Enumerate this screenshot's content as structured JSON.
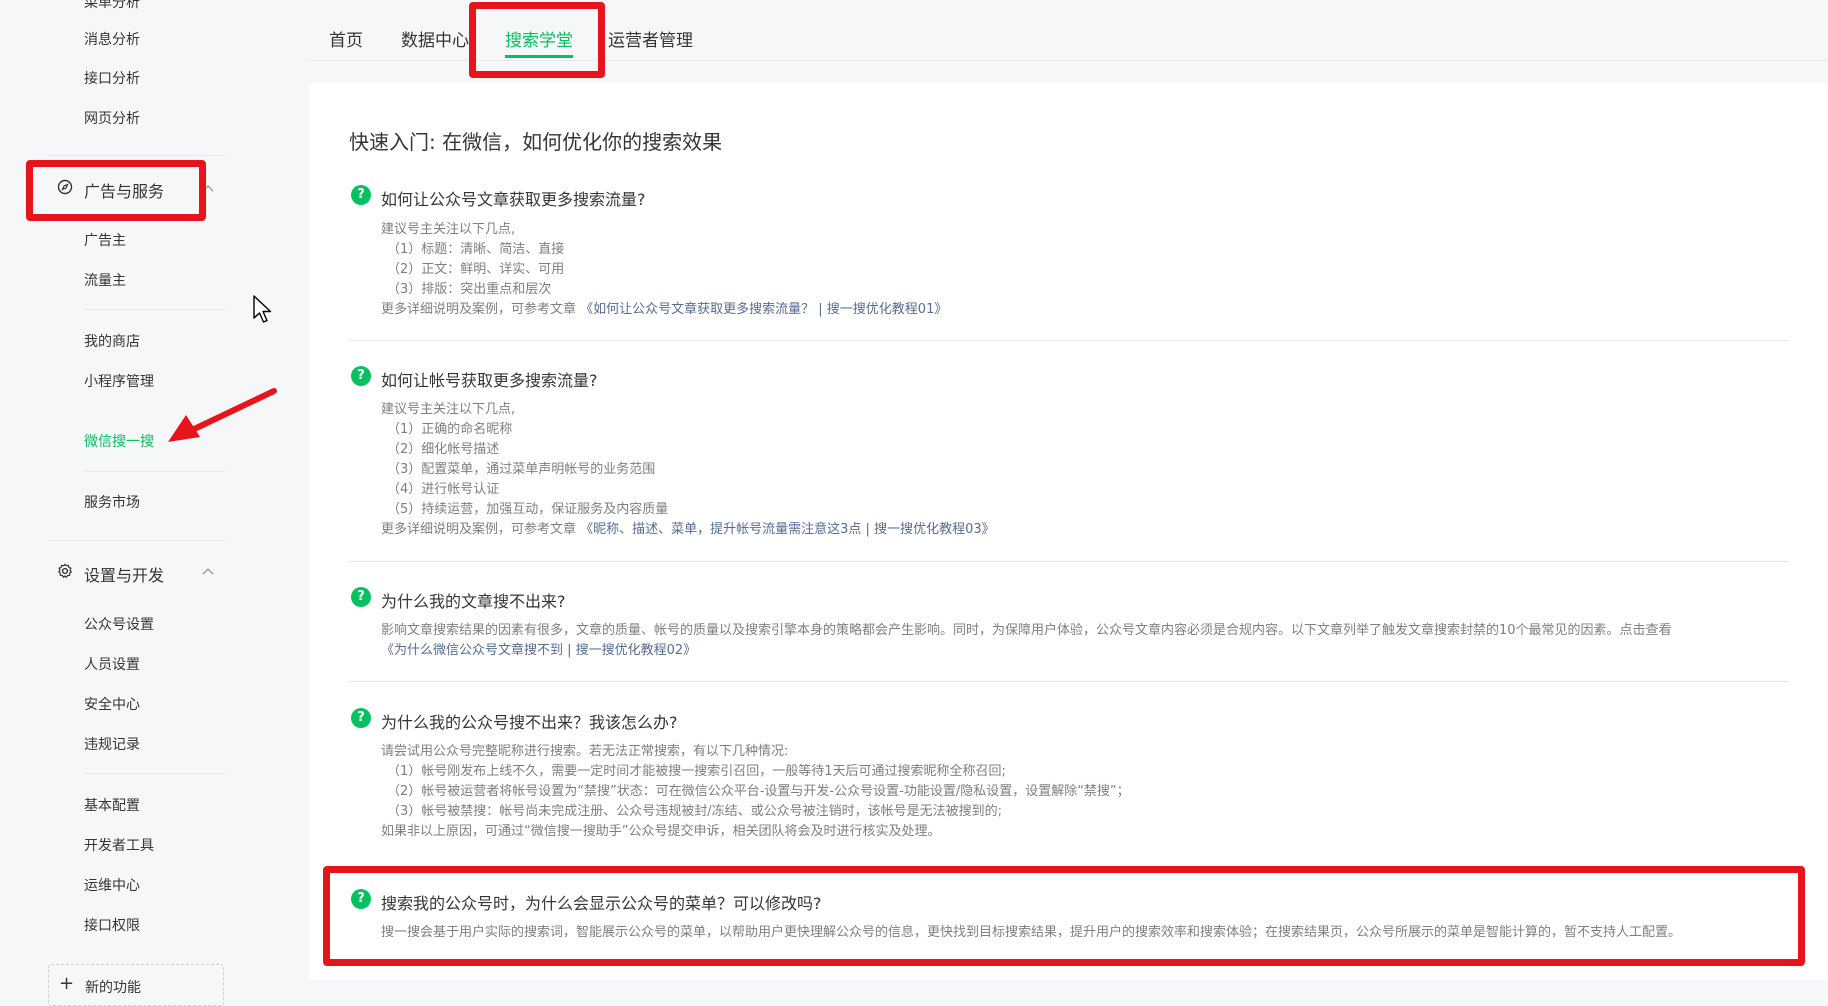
{
  "sidebar": {
    "top_partial": "菜单分析",
    "group_stats": [
      "消息分析",
      "接口分析",
      "网页分析"
    ],
    "ads_header": "广告与服务",
    "ads_items": [
      "广告主",
      "流量主"
    ],
    "store_items": [
      "我的商店",
      "小程序管理",
      "微信搜一搜"
    ],
    "market_items": [
      "服务市场"
    ],
    "settings_header": "设置与开发",
    "settings_items": [
      "公众号设置",
      "人员设置",
      "安全中心",
      "违规记录"
    ],
    "dev_items": [
      "基本配置",
      "开发者工具",
      "运维中心",
      "接口权限"
    ],
    "new_function": "新的功能",
    "active_item": "微信搜一搜"
  },
  "tabs": [
    "首页",
    "数据中心",
    "搜索学堂",
    "运营者管理"
  ],
  "active_tab": "搜索学堂",
  "page_title": "快速入门: 在微信，如何优化你的搜索效果",
  "sections": [
    {
      "title": "如何让公众号文章获取更多搜索流量?",
      "lines": [
        "建议号主关注以下几点,",
        "（1）标题：清晰、简洁、直接",
        "（2）正文：鲜明、详实、可用",
        "（3）排版：突出重点和层次"
      ],
      "more_prefix": "更多详细说明及案例，可参考文章",
      "link": "《如何让公众号文章获取更多搜索流量？ | 搜一搜优化教程01》"
    },
    {
      "title": "如何让帐号获取更多搜索流量?",
      "lines": [
        "建议号主关注以下几点,",
        "（1）正确的命名昵称",
        "（2）细化帐号描述",
        "（3）配置菜单，通过菜单声明帐号的业务范围",
        "（4）进行帐号认证",
        "（5）持续运营，加强互动，保证服务及内容质量"
      ],
      "more_prefix": "更多详细说明及案例，可参考文章",
      "link": "《昵称、描述、菜单，提升帐号流量需注意这3点 | 搜一搜优化教程03》"
    },
    {
      "title": "为什么我的文章搜不出来?",
      "lines": [
        "影响文章搜索结果的因素有很多，文章的质量、帐号的质量以及搜索引擎本身的策略都会产生影响。同时，为保障用户体验，公众号文章内容必须是合规内容。以下文章列举了触发文章搜索封禁的10个最常见的因素。点击查看"
      ],
      "link": "《为什么微信公众号文章搜不到 | 搜一搜优化教程02》"
    },
    {
      "title": "为什么我的公众号搜不出来？我该怎么办?",
      "lines": [
        "请尝试用公众号完整昵称进行搜索。若无法正常搜索，有以下几种情况:",
        "（1）帐号刚发布上线不久，需要一定时间才能被搜一搜索引召回，一般等待1天后可通过搜索昵称全称召回;",
        "（2）帐号被运营者将帐号设置为“禁搜”状态：可在微信公众平台-设置与开发-公众号设置-功能设置/隐私设置，设置解除“禁搜”；",
        "（3）帐号被禁搜：帐号尚未完成注册、公众号违规被封/冻结、或公众号被注销时，该帐号是无法被搜到的;",
        "如果非以上原因，可通过“微信搜一搜助手”公众号提交申诉，相关团队将会及时进行核实及处理。"
      ]
    },
    {
      "title": "搜索我的公众号时，为什么会显示公众号的菜单？可以修改吗?",
      "lines": [
        "搜一搜会基于用户实际的搜索词，智能展示公众号的菜单，以帮助用户更快理解公众号的信息，更快找到目标搜索结果，提升用户的搜索效率和搜索体验；在搜索结果页，公众号所展示的菜单是智能计算的，暂不支持人工配置。"
      ]
    }
  ],
  "icons": {
    "question": "?",
    "plus": "+"
  },
  "colors": {
    "accent": "#07c160",
    "link": "#576b95",
    "annotation": "#e8141c"
  }
}
